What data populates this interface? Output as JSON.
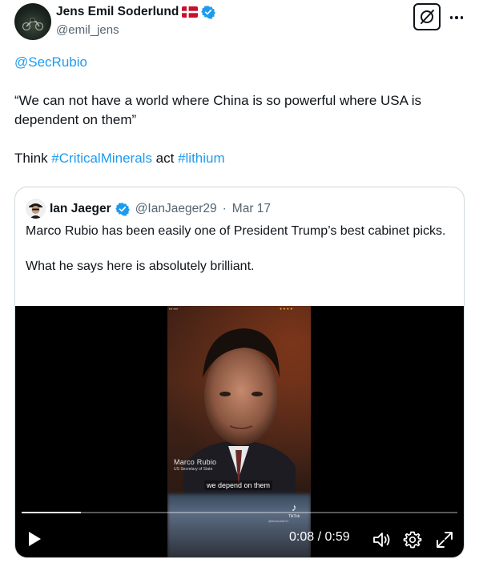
{
  "author": {
    "name": "Jens Emil Soderlund",
    "handle": "@emil_jens",
    "flag": "Denmark",
    "verified": true
  },
  "tweet": {
    "mention": "@SecRubio",
    "quote_line": "“We can not have a world where China is so powerful where USA is dependent on them”",
    "think_prefix": "Think ",
    "hashtag_1": "#CriticalMinerals",
    "middle_word": " act ",
    "hashtag_2": "#lithium"
  },
  "quoted_tweet": {
    "name": "Ian Jaeger",
    "handle": "@IanJaeger29",
    "separator": "·",
    "date": "Mar 17",
    "verified": true,
    "text_line_1": "Marco Rubio has been easily one of President Trump’s best cabinet picks.",
    "text_line_2": "What he says here is absolutely brilliant."
  },
  "video": {
    "caption_name": "Marco Rubio",
    "caption_role": "US Secretary of State",
    "subtitle": "we depend on them",
    "tiktok_label": "TikTok",
    "tiktok_user": "@theworldCH",
    "current_time": "0:08",
    "time_separator": " / ",
    "duration": "0:59",
    "progress": 0.136
  },
  "icons": {
    "grok": "grok-icon",
    "more": "more-options-icon",
    "play": "play-icon",
    "volume": "volume-icon",
    "settings": "gear-icon",
    "fullscreen": "fullscreen-icon"
  },
  "colors": {
    "link": "#1d9bf0",
    "verified": "#1d9bf0",
    "text": "#0f1419",
    "secondary": "#536471"
  }
}
